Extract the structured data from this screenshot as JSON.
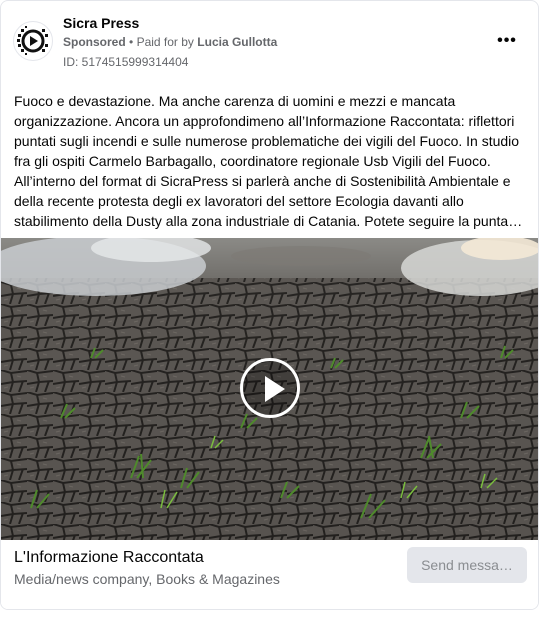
{
  "ad": {
    "page_name": "Sicra Press",
    "sponsored": "Sponsored",
    "separator": "•",
    "paid_for_by": "Paid for by",
    "payer": "Lucia Gullotta",
    "id_line": "ID: 5174515999314404",
    "more_icon": "more-horizontal-icon",
    "logo_icon": "play-circle-logo"
  },
  "body": {
    "lines": [
      "Fuoco e devastazione. Ma anche carenza di uomini e mezzi e mancata",
      "organizzazione. Ancora un approfondimeno all’Informazione Raccontata: riflettori",
      "puntati sugli incendi e sulle numerose problematiche dei vigili del Fuoco. In studio",
      "fra gli ospiti Carmelo Barbagallo, coordinatore regionale Usb Vigili del Fuoco.",
      "All’interno del format di SicraPress si parlerà anche di Sostenibilità Ambientale e",
      "della recente protesta degli ex lavoratori del settore Ecologia davanti allo",
      "stabilimento della Dusty alla zona industriale di Catania. Potete seguire la puntata…"
    ]
  },
  "media": {
    "type": "video",
    "play_icon": "play-icon"
  },
  "footer": {
    "title": "L'Informazione Raccontata",
    "subtitle": "Media/news company, Books & Magazines",
    "cta_label": "Send messa…"
  },
  "colors": {
    "secondary_text": "#65676b",
    "button_bg": "#e4e6eb",
    "button_text": "#8a8d91"
  }
}
